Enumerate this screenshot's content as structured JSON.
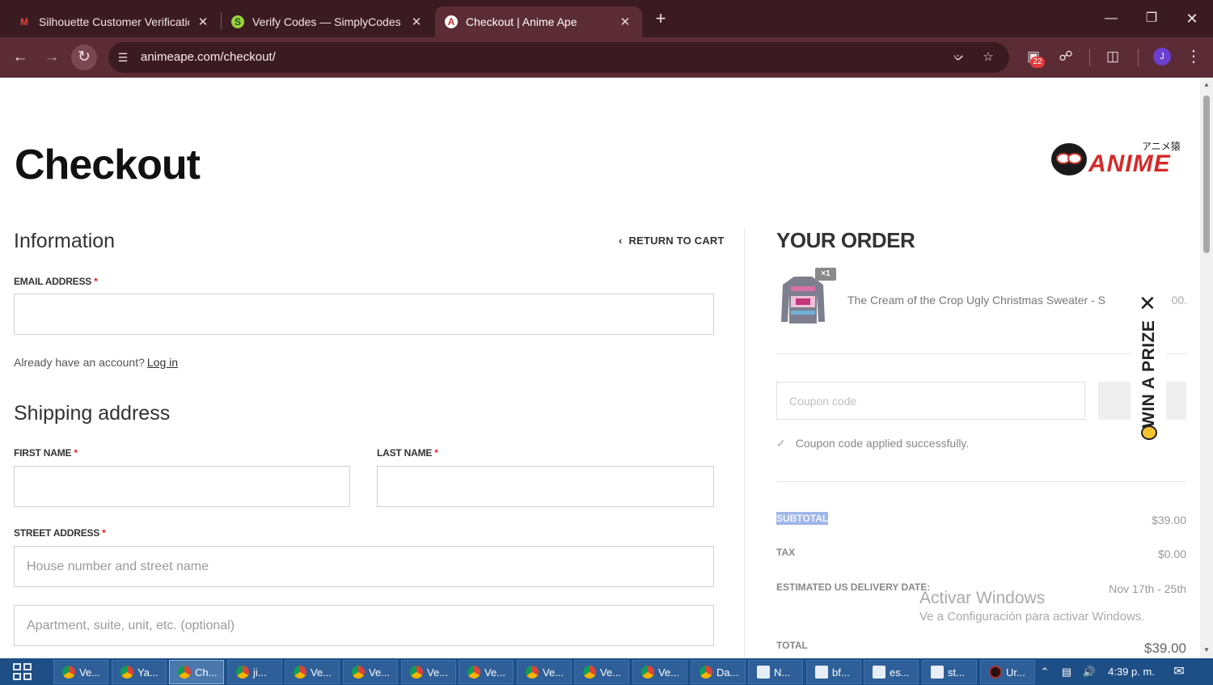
{
  "browser": {
    "tabs": [
      {
        "title": "Silhouette Customer Verification",
        "favicon": "M"
      },
      {
        "title": "Verify Codes — SimplyCodes",
        "favicon": "S"
      },
      {
        "title": "Checkout | Anime Ape",
        "favicon": "A",
        "active": true
      }
    ],
    "new_tab": "+",
    "url": "animeape.com/checkout/",
    "extensions_badge": "22",
    "profile_initial": "J"
  },
  "page": {
    "title": "Checkout",
    "logo": {
      "wordmark": "ANIME",
      "kana": "アニメ猿"
    },
    "information_heading": "Information",
    "return_to_cart": "RETURN TO CART",
    "email_label": "EMAIL ADDRESS",
    "required_mark": "*",
    "account_prompt": "Already have an account?",
    "login_link": "Log in",
    "shipping_heading": "Shipping address",
    "first_name_label": "FIRST NAME",
    "last_name_label": "LAST NAME",
    "street_label": "STREET ADDRESS",
    "street_placeholder": "House number and street name",
    "apartment_placeholder": "Apartment, suite, unit, etc. (optional)"
  },
  "order": {
    "heading": "YOUR ORDER",
    "item": {
      "name": "The Cream of the Crop Ugly Christmas Sweater - S",
      "quantity": "×1",
      "price": ".00"
    },
    "coupon_placeholder": "Coupon code",
    "coupon_message": "Coupon code applied successfully.",
    "rows": [
      {
        "label": "SUBTOTAL",
        "value": "$39.00"
      },
      {
        "label": "TAX",
        "value": "$0.00"
      },
      {
        "label": "ESTIMATED US DELIVERY DATE:",
        "value": "Nov 17th - 25th"
      },
      {
        "label": "TOTAL",
        "value": "$39.00"
      }
    ]
  },
  "prize_widget": {
    "label": "WIN A PRIZE",
    "close": "✕"
  },
  "watermark": {
    "line1": "Activar Windows",
    "line2": "Ve a Configuración para activar Windows."
  },
  "taskbar": {
    "buttons": [
      "Ve...",
      "Ya...",
      "Ch...",
      "ji...",
      "Ve...",
      "Ve...",
      "Ve...",
      "Ve...",
      "Ve...",
      "Ve...",
      "Ve...",
      "Da...",
      "N...",
      "bf...",
      "es...",
      "st...",
      "Ur..."
    ],
    "clock": "4:39 p. m."
  },
  "colors": {
    "accent": "#d42a2a",
    "chrome_tabbar": "#3b1b22",
    "chrome_toolbar": "#5b2c36",
    "taskbar": "#1e4e86"
  }
}
